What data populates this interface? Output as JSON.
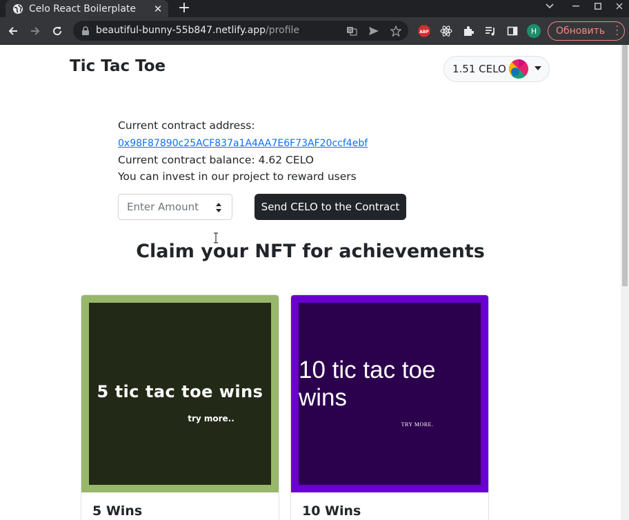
{
  "browser": {
    "tab_title": "Celo React Boilerplate",
    "url_host": "beautiful-bunny-55b847.netlify.app",
    "url_path": "/profile",
    "profile_initial": "H",
    "update_label": "Обновить",
    "abp_label": "ABP"
  },
  "header": {
    "brand": "Tic Tac Toe",
    "wallet_balance": "1.51 CELO"
  },
  "contract": {
    "address_label": "Current contract address:",
    "address": " 0x98F87890c25ACF837a1A4AA7E6F73AF20ccf4ebf",
    "balance_text": "Current contract balance: 4.62 CELO",
    "invite_text": "You can invest in our project to reward users"
  },
  "send_form": {
    "amount_placeholder": "Enter Amount",
    "send_label": "Send CELO to the Contract"
  },
  "nft_section": {
    "title": "Claim your NFT for achievements",
    "cards": [
      {
        "title": "5 Wins",
        "image_text": "5 tic tac toe wins",
        "image_subtext": "try more..",
        "frame_color": "#98b76a",
        "bg_color": "#222a17"
      },
      {
        "title": "10 Wins",
        "image_text": "10 tic tac toe wins",
        "image_subtext": "TRY MORE.",
        "frame_color": "#6a00d0",
        "bg_color": "#2b004d"
      }
    ]
  }
}
